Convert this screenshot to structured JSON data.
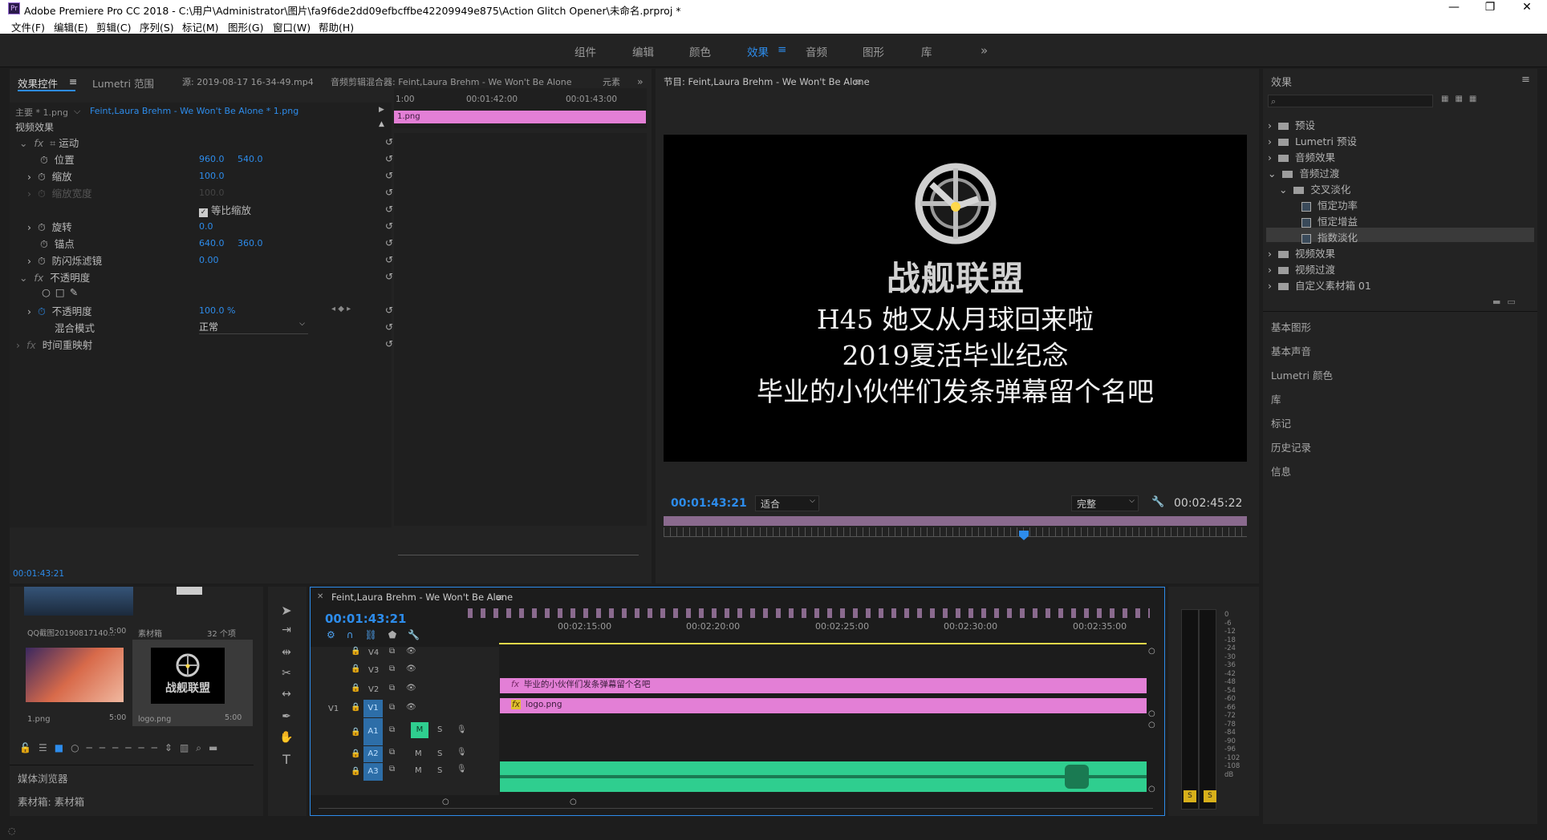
{
  "window": {
    "title": "Adobe Premiere Pro CC 2018 - C:\\用户\\Administrator\\图片\\fa9f6de2dd09efbcffbe42209949e875\\Action Glitch Opener\\未命名.prproj *",
    "logo": "Pr",
    "min": "—",
    "restore": "❐",
    "close": "✕"
  },
  "menu": [
    "文件(F)",
    "编辑(E)",
    "剪辑(C)",
    "序列(S)",
    "标记(M)",
    "图形(G)",
    "窗口(W)",
    "帮助(H)"
  ],
  "workspaces": [
    "组件",
    "编辑",
    "颜色",
    "效果",
    "音频",
    "图形",
    "库"
  ],
  "workspace_more": "»",
  "effect_controls": {
    "tabs": [
      "效果控件",
      "Lumetri 范围",
      "源: 2019-08-17 16-34-49.mp4",
      "音频剪辑混合器: Feint,Laura Brehm - We Won't Be Alone",
      "元素"
    ],
    "master": "主要 * 1.png",
    "sequence_clip": "Feint,Laura Brehm - We Won't Be Alone * 1.png",
    "section": "视频效果",
    "rows": [
      {
        "label": "运动"
      },
      {
        "label": "位置",
        "v1": "960.0",
        "v2": "540.0"
      },
      {
        "label": "缩放",
        "v1": "100.0"
      },
      {
        "label": "缩放宽度",
        "v1": "100.0"
      },
      {
        "label": "等比缩放"
      },
      {
        "label": "旋转",
        "v1": "0.0"
      },
      {
        "label": "锚点",
        "v1": "640.0",
        "v2": "360.0"
      },
      {
        "label": "防闪烁滤镜",
        "v1": "0.00"
      },
      {
        "label": "不透明度"
      },
      {
        "label": "不透明度",
        "v1": "100.0 %"
      },
      {
        "label": "混合模式",
        "v1": "正常"
      },
      {
        "label": "时间重映射"
      }
    ],
    "mini_times": [
      "1:00",
      "00:01:42:00",
      "00:01:43:00"
    ],
    "mini_clip": "1.png",
    "timecode": "00:01:43:21"
  },
  "program": {
    "title": "节目: Feint,Laura Brehm - We Won't Be Alone",
    "logo_text": "战舰联盟",
    "lines": [
      "H45 她又从月球回来啦",
      "2019夏活毕业纪念",
      "毕业的小伙伴们发条弹幕留个名吧"
    ],
    "timecode": "00:01:43:21",
    "fit": "适合",
    "quality": "完整",
    "duration": "00:02:45:22"
  },
  "effects": {
    "title": "效果",
    "search_placeholder": "",
    "tree": [
      "预设",
      "Lumetri 预设",
      "音频效果",
      "音频过渡",
      "交叉淡化",
      "恒定功率",
      "恒定增益",
      "指数淡化",
      "视频效果",
      "视频过渡",
      "自定义素材箱 01"
    ],
    "panels": [
      "基本图形",
      "基本声音",
      "Lumetri 颜色",
      "库",
      "标记",
      "历史记录",
      "信息"
    ]
  },
  "project": {
    "items": [
      {
        "name": "QQ截图20190817140...",
        "dur": "5:00"
      },
      {
        "name": "素材箱",
        "dur": "32 个项"
      },
      {
        "name": "1.png",
        "dur": "5:00"
      },
      {
        "name": "logo.png",
        "dur": "5:00"
      }
    ],
    "media_browser": "媒体浏览器",
    "bin": "素材箱: 素材箱"
  },
  "timeline": {
    "title": "Feint,Laura Brehm - We Won't Be Alone",
    "timecode": "00:01:43:21",
    "ruler": [
      "00:02:15:00",
      "00:02:20:00",
      "00:02:25:00",
      "00:02:30:00",
      "00:02:35:00"
    ],
    "tracks": [
      "V4",
      "V3",
      "V2",
      "V1",
      "A1",
      "A2",
      "A3"
    ],
    "v_src": "V1",
    "m": "M",
    "s": "S",
    "clip_v2": "毕业的小伙伴们发条弹幕留个名吧",
    "clip_v1": "logo.png"
  },
  "meter": {
    "labels": [
      "0",
      "-6",
      "-12",
      "-18",
      "-24",
      "-30",
      "-36",
      "-42",
      "-48",
      "-54",
      "-60",
      "-66",
      "-72",
      "-78",
      "-84",
      "-90",
      "-96",
      "-102",
      "-108",
      "dB"
    ],
    "solo": "S"
  },
  "colors": {
    "accent": "#2d8ceb",
    "clip_pink": "#e37fd6",
    "audio_green": "#2fce8f"
  }
}
